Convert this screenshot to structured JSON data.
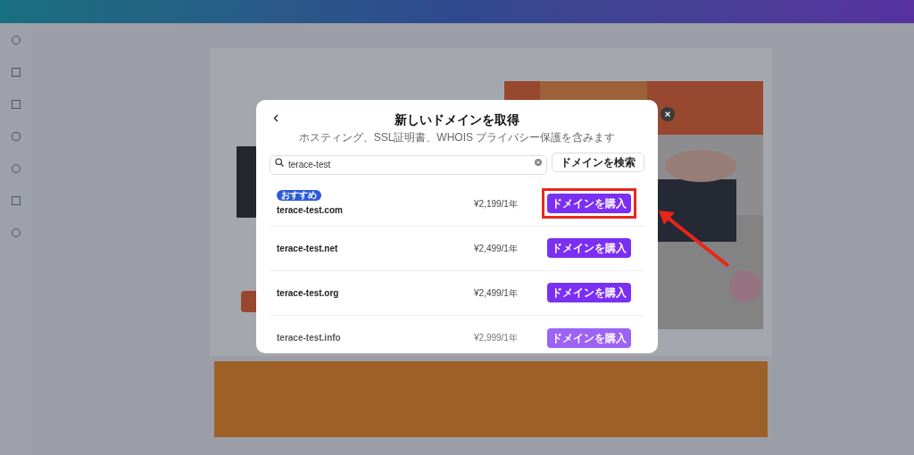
{
  "dialog": {
    "title": "新しいドメインを取得",
    "subtitle": "ホスティング、SSL証明書、WHOIS プライバシー保護を含みます",
    "search": {
      "value": "terace-test"
    },
    "search_button": "ドメインを検索",
    "domains": [
      {
        "badge": "おすすめ",
        "name": "terace-test.com",
        "price": "¥2,199/1年",
        "button": "ドメインを購入",
        "highlighted": true,
        "faded": false
      },
      {
        "name": "terace-test.net",
        "price": "¥2,499/1年",
        "button": "ドメインを購入",
        "highlighted": false,
        "faded": false
      },
      {
        "name": "terace-test.org",
        "price": "¥2,499/1年",
        "button": "ドメインを購入",
        "highlighted": false,
        "faded": false
      },
      {
        "name": "terace-test.info",
        "price": "¥2,999/1年",
        "button": "ドメインを購入",
        "highlighted": false,
        "faded": true
      }
    ]
  }
}
